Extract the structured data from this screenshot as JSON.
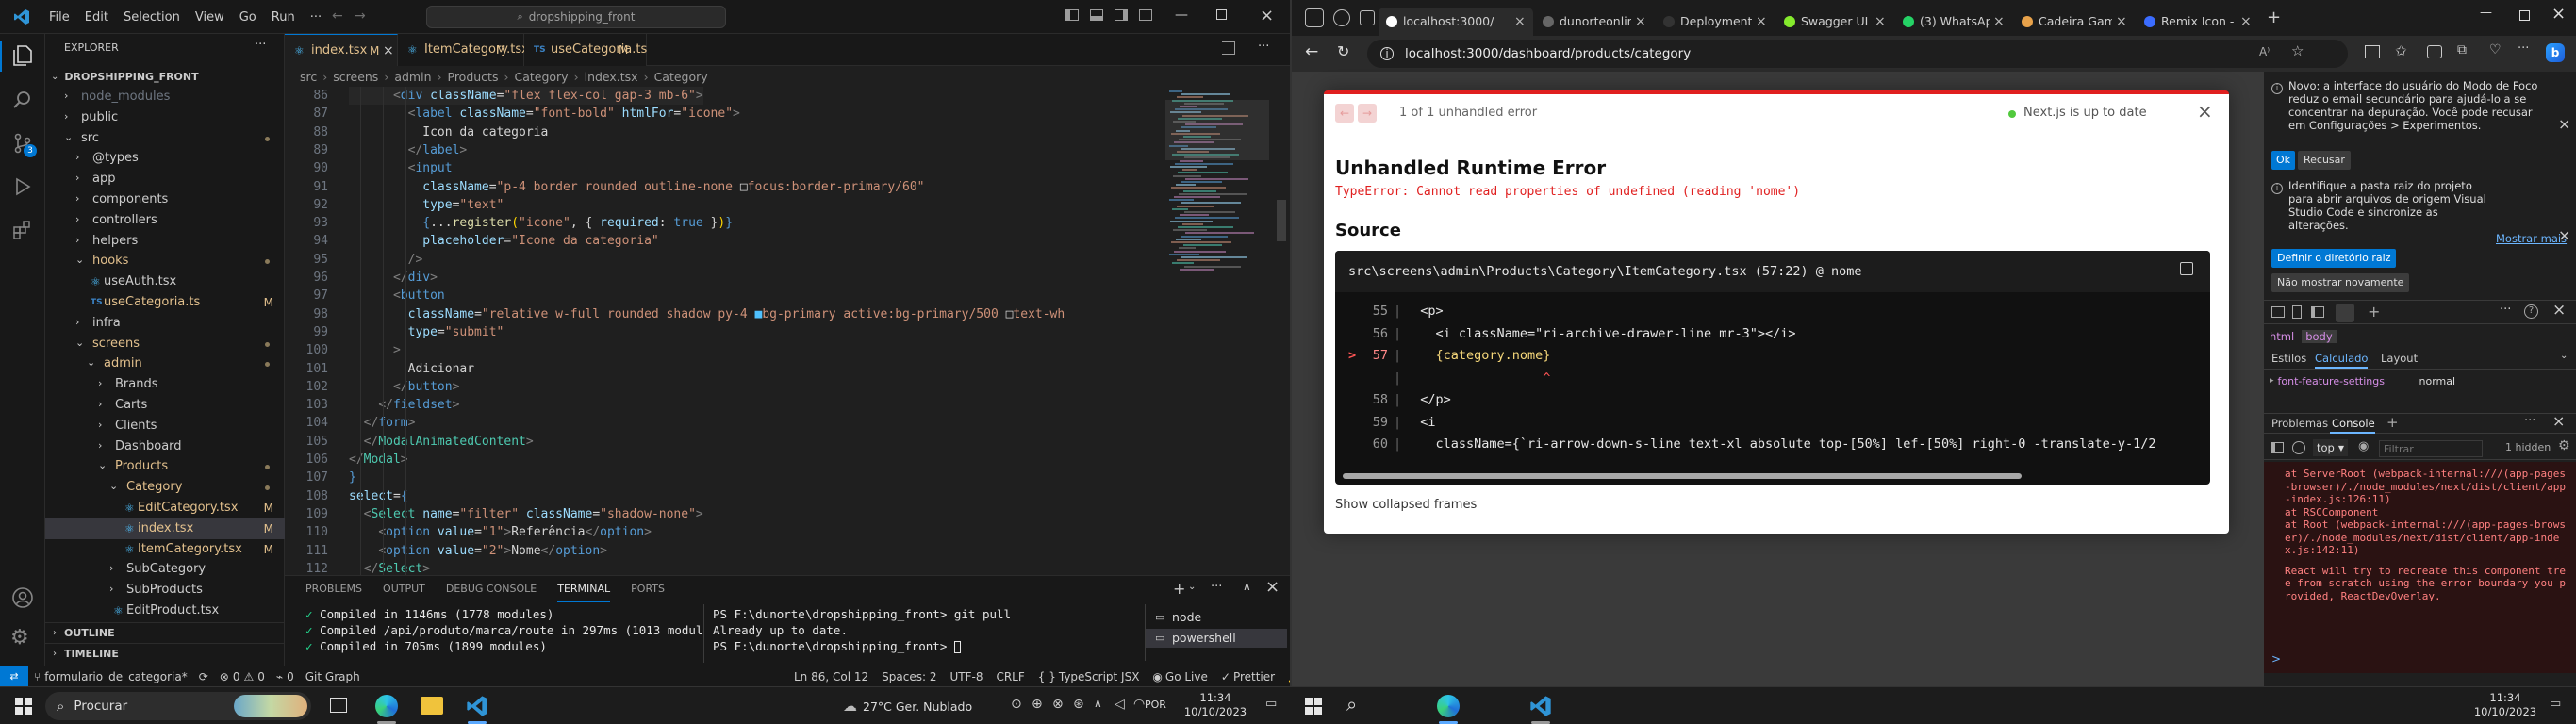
{
  "vscode": {
    "menu": [
      "File",
      "Edit",
      "Selection",
      "View",
      "Go",
      "Run"
    ],
    "menu_more": "···",
    "search_text": "dropshipping_front",
    "explorer": {
      "title": "EXPLORER",
      "more": "···",
      "root": "DROPSHIPPING_FRONT",
      "items": [
        {
          "label": "node_modules",
          "indent": 1,
          "kind": "folder",
          "open": false,
          "color": "#6e7681"
        },
        {
          "label": "public",
          "indent": 1,
          "kind": "folder",
          "open": false,
          "color": "#cccccc"
        },
        {
          "label": "src",
          "indent": 1,
          "kind": "folder",
          "open": true,
          "color": "#cccccc",
          "dot": true
        },
        {
          "label": "@types",
          "indent": 2,
          "kind": "folder",
          "open": false,
          "color": "#cccccc"
        },
        {
          "label": "app",
          "indent": 2,
          "kind": "folder",
          "open": false,
          "color": "#cccccc"
        },
        {
          "label": "components",
          "indent": 2,
          "kind": "folder",
          "open": false,
          "color": "#cccccc"
        },
        {
          "label": "controllers",
          "indent": 2,
          "kind": "folder",
          "open": false,
          "color": "#cccccc"
        },
        {
          "label": "helpers",
          "indent": 2,
          "kind": "folder",
          "open": false,
          "color": "#cccccc"
        },
        {
          "label": "hooks",
          "indent": 2,
          "kind": "folder",
          "open": true,
          "color": "#e2c08d",
          "dot": true
        },
        {
          "label": "useAuth.tsx",
          "indent": 3,
          "kind": "file",
          "color": "#cccccc"
        },
        {
          "label": "useCategoria.ts",
          "indent": 3,
          "kind": "file",
          "color": "#e2c08d",
          "badge": "M"
        },
        {
          "label": "infra",
          "indent": 2,
          "kind": "folder",
          "open": false,
          "color": "#cccccc"
        },
        {
          "label": "screens",
          "indent": 2,
          "kind": "folder",
          "open": true,
          "color": "#e2c08d",
          "dot": true
        },
        {
          "label": "admin",
          "indent": 3,
          "kind": "folder",
          "open": true,
          "color": "#e2c08d",
          "dot": true
        },
        {
          "label": "Brands",
          "indent": 4,
          "kind": "folder",
          "open": false,
          "color": "#cccccc"
        },
        {
          "label": "Carts",
          "indent": 4,
          "kind": "folder",
          "open": false,
          "color": "#cccccc"
        },
        {
          "label": "Clients",
          "indent": 4,
          "kind": "folder",
          "open": false,
          "color": "#cccccc"
        },
        {
          "label": "Dashboard",
          "indent": 4,
          "kind": "folder",
          "open": false,
          "color": "#cccccc"
        },
        {
          "label": "Products",
          "indent": 4,
          "kind": "folder",
          "open": true,
          "color": "#e2c08d",
          "dot": true
        },
        {
          "label": "Category",
          "indent": 5,
          "kind": "folder",
          "open": true,
          "color": "#e2c08d",
          "dot": true
        },
        {
          "label": "EditCategory.tsx",
          "indent": 6,
          "kind": "file",
          "color": "#e2c08d",
          "badge": "M"
        },
        {
          "label": "index.tsx",
          "indent": 6,
          "kind": "file",
          "color": "#e2c08d",
          "badge": "M",
          "selected": true
        },
        {
          "label": "ItemCategory.tsx",
          "indent": 6,
          "kind": "file",
          "color": "#e2c08d",
          "badge": "M"
        },
        {
          "label": "SubCategory",
          "indent": 5,
          "kind": "folder",
          "open": false,
          "color": "#cccccc"
        },
        {
          "label": "SubProducts",
          "indent": 5,
          "kind": "folder",
          "open": false,
          "color": "#cccccc"
        },
        {
          "label": "EditProduct.tsx",
          "indent": 5,
          "kind": "file",
          "color": "#cccccc"
        }
      ],
      "outline": "OUTLINE",
      "timeline": "TIMELINE"
    },
    "tabs": [
      {
        "label": "index.tsx",
        "badge": "M",
        "active": true,
        "close": "×"
      },
      {
        "label": "ItemCategory.tsx",
        "badge": "M",
        "active": false
      },
      {
        "label": "useCategoria.ts",
        "badge": "M",
        "active": false
      }
    ],
    "breadcrumb": [
      "src",
      "screens",
      "admin",
      "Products",
      "Category",
      "index.tsx",
      "Category"
    ],
    "code": [
      {
        "n": "86",
        "parts": [
          [
            "      ",
            "tt"
          ],
          [
            "<",
            "tp"
          ],
          [
            "div",
            "tk"
          ],
          [
            " className",
            "ta"
          ],
          [
            "=",
            "tt"
          ],
          [
            "\"flex flex-col gap-3 mb-6\"",
            "ts"
          ],
          [
            ">",
            "tp"
          ]
        ]
      },
      {
        "n": "87",
        "parts": [
          [
            "        ",
            "tt"
          ],
          [
            "<",
            "tp"
          ],
          [
            "label",
            "tk"
          ],
          [
            " className",
            "ta"
          ],
          [
            "=",
            "tt"
          ],
          [
            "\"font-bold\"",
            "ts"
          ],
          [
            " htmlFor",
            "ta"
          ],
          [
            "=",
            "tt"
          ],
          [
            "\"icone\"",
            "ts"
          ],
          [
            ">",
            "tp"
          ]
        ]
      },
      {
        "n": "88",
        "parts": [
          [
            "          Icon da categoria",
            "tt"
          ]
        ]
      },
      {
        "n": "89",
        "parts": [
          [
            "        ",
            "tt"
          ],
          [
            "</",
            "tp"
          ],
          [
            "label",
            "tk"
          ],
          [
            ">",
            "tp"
          ]
        ]
      },
      {
        "n": "90",
        "parts": [
          [
            "        ",
            "tt"
          ],
          [
            "<",
            "tp"
          ],
          [
            "input",
            "tk"
          ]
        ]
      },
      {
        "n": "91",
        "parts": [
          [
            "          className",
            "ta"
          ],
          [
            "=",
            "tt"
          ],
          [
            "\"p-4 border rounded outline-none ",
            "ts"
          ],
          [
            "□",
            "tt"
          ],
          [
            "focus:border-primary/60\"",
            "ts"
          ]
        ]
      },
      {
        "n": "92",
        "parts": [
          [
            "          type",
            "ta"
          ],
          [
            "=",
            "tt"
          ],
          [
            "\"text\"",
            "ts"
          ]
        ]
      },
      {
        "n": "93",
        "parts": [
          [
            "          {",
            "tk"
          ],
          [
            "...",
            "tt"
          ],
          [
            "register",
            "ty"
          ],
          [
            "(",
            "tb"
          ],
          [
            "\"icone\"",
            "ts"
          ],
          [
            ", { ",
            "tt"
          ],
          [
            "required",
            "ta"
          ],
          [
            ": ",
            "tt"
          ],
          [
            "true",
            "tk"
          ],
          [
            " }",
            "tt"
          ],
          [
            ")",
            "tb"
          ],
          [
            "}",
            "tk"
          ]
        ]
      },
      {
        "n": "94",
        "parts": [
          [
            "          placeholder",
            "ta"
          ],
          [
            "=",
            "tt"
          ],
          [
            "\"Icone da categoria\"",
            "ts"
          ]
        ]
      },
      {
        "n": "95",
        "parts": [
          [
            "        />",
            "tp"
          ]
        ]
      },
      {
        "n": "96",
        "parts": [
          [
            "      ",
            "tt"
          ],
          [
            "</",
            "tp"
          ],
          [
            "div",
            "tk"
          ],
          [
            ">",
            "tp"
          ]
        ]
      },
      {
        "n": "97",
        "parts": [
          [
            "      ",
            "tt"
          ],
          [
            "<",
            "tp"
          ],
          [
            "button",
            "tk"
          ]
        ]
      },
      {
        "n": "98",
        "parts": [
          [
            "        className",
            "ta"
          ],
          [
            "=",
            "tt"
          ],
          [
            "\"relative w-full rounded shadow py-4 ",
            "ts"
          ],
          [
            "■",
            "tv"
          ],
          [
            "bg-primary active:bg-primary/500 ",
            "ts"
          ],
          [
            "□",
            "tt"
          ],
          [
            "text-wh",
            "ts"
          ]
        ]
      },
      {
        "n": "99",
        "parts": [
          [
            "        type",
            "ta"
          ],
          [
            "=",
            "tt"
          ],
          [
            "\"submit\"",
            "ts"
          ]
        ]
      },
      {
        "n": "100",
        "parts": [
          [
            "      ",
            "tt"
          ],
          [
            ">",
            "tp"
          ]
        ]
      },
      {
        "n": "101",
        "parts": [
          [
            "        Adicionar",
            "tt"
          ]
        ]
      },
      {
        "n": "102",
        "parts": [
          [
            "      ",
            "tt"
          ],
          [
            "</",
            "tp"
          ],
          [
            "button",
            "tk"
          ],
          [
            ">",
            "tp"
          ]
        ]
      },
      {
        "n": "103",
        "parts": [
          [
            "    ",
            "tt"
          ],
          [
            "</",
            "tp"
          ],
          [
            "fieldset",
            "tk"
          ],
          [
            ">",
            "tp"
          ]
        ]
      },
      {
        "n": "104",
        "parts": [
          [
            "  ",
            "tt"
          ],
          [
            "</",
            "tp"
          ],
          [
            "form",
            "tk"
          ],
          [
            ">",
            "tp"
          ]
        ]
      },
      {
        "n": "105",
        "parts": [
          [
            "  ",
            "tt"
          ],
          [
            "</",
            "tp"
          ],
          [
            "ModalAnimatedContent",
            "tc"
          ],
          [
            ">",
            "tp"
          ]
        ]
      },
      {
        "n": "106",
        "parts": [
          [
            "</",
            "tp"
          ],
          [
            "Modal",
            "tc"
          ],
          [
            ">",
            "tp"
          ]
        ]
      },
      {
        "n": "107",
        "parts": [
          [
            "}",
            "tk"
          ]
        ]
      },
      {
        "n": "108",
        "parts": [
          [
            "select",
            "ta"
          ],
          [
            "=",
            "tt"
          ],
          [
            "{",
            "tk"
          ]
        ]
      },
      {
        "n": "109",
        "parts": [
          [
            "  ",
            "tt"
          ],
          [
            "<",
            "tp"
          ],
          [
            "Select",
            "tc"
          ],
          [
            " name",
            "ta"
          ],
          [
            "=",
            "tt"
          ],
          [
            "\"filter\"",
            "ts"
          ],
          [
            " className",
            "ta"
          ],
          [
            "=",
            "tt"
          ],
          [
            "\"shadow-none\"",
            "ts"
          ],
          [
            ">",
            "tp"
          ]
        ]
      },
      {
        "n": "110",
        "parts": [
          [
            "    ",
            "tt"
          ],
          [
            "<",
            "tp"
          ],
          [
            "option",
            "tk"
          ],
          [
            " value",
            "ta"
          ],
          [
            "=",
            "tt"
          ],
          [
            "\"1\"",
            "ts"
          ],
          [
            ">",
            "tp"
          ],
          [
            "Referência",
            "tt"
          ],
          [
            "</",
            "tp"
          ],
          [
            "option",
            "tk"
          ],
          [
            ">",
            "tp"
          ]
        ]
      },
      {
        "n": "111",
        "parts": [
          [
            "    ",
            "tt"
          ],
          [
            "<",
            "tp"
          ],
          [
            "option",
            "tk"
          ],
          [
            " value",
            "ta"
          ],
          [
            "=",
            "tt"
          ],
          [
            "\"2\"",
            "ts"
          ],
          [
            ">",
            "tp"
          ],
          [
            "Nome",
            "tt"
          ],
          [
            "</",
            "tp"
          ],
          [
            "option",
            "tk"
          ],
          [
            ">",
            "tp"
          ]
        ]
      },
      {
        "n": "112",
        "parts": [
          [
            "  ",
            "tt"
          ],
          [
            "</",
            "tp"
          ],
          [
            "Select",
            "tc"
          ],
          [
            ">",
            "tp"
          ]
        ]
      }
    ],
    "panel": {
      "tabs": [
        "PROBLEMS",
        "OUTPUT",
        "DEBUG CONSOLE",
        "TERMINAL",
        "PORTS"
      ],
      "active_tab": "TERMINAL",
      "left_lines": [
        "Compiled in 1146ms (1778 modules)",
        "Compiled /api/produto/marca/route in 297ms (1013 modules)",
        "Compiled in 705ms (1899 modules)"
      ],
      "right_lines": [
        "PS F:\\dunorte\\dropshipping_front> git pull",
        "Already up to date.",
        "PS F:\\dunorte\\dropshipping_front> "
      ],
      "terminals": [
        "node",
        "powershell"
      ]
    },
    "status": {
      "branch": "formulario_de_categoria*",
      "errors": "0",
      "warnings": "0",
      "ports": "0",
      "git_graph": "Git Graph",
      "position": "Ln 86, Col 12",
      "spaces": "Spaces: 2",
      "encoding": "UTF-8",
      "eol": "CRLF",
      "language": "TypeScript JSX",
      "golive": "Go Live",
      "prettier": "Prettier"
    }
  },
  "browser": {
    "tabs": [
      {
        "label": "localhost:3000/",
        "active": true
      },
      {
        "label": "dunorteonline/d"
      },
      {
        "label": "Deployments"
      },
      {
        "label": "Swagger UI"
      },
      {
        "label": "(3) WhatsApp"
      },
      {
        "label": "Cadeira Gamin"
      },
      {
        "label": "Remix Icon - Op"
      }
    ],
    "url": "localhost:3000/dashboard/products/category",
    "error": {
      "counter": "1 of 1 unhandled error",
      "next_status": "Next.js is up to date",
      "title": "Unhandled Runtime Error",
      "message": "TypeError: Cannot read properties of undefined (reading 'nome')",
      "source_title": "Source",
      "file": "src\\screens\\admin\\Products\\Category\\ItemCategory.tsx (57:22) @ nome",
      "code": [
        {
          "n": "55",
          "text": "  <p>",
          "marker": ""
        },
        {
          "n": "56",
          "text": "    <i className=\"ri-archive-drawer-line mr-3\"></i>",
          "marker": ""
        },
        {
          "n": "57",
          "text": "    {category.nome}",
          "marker": ">"
        },
        {
          "n": "",
          "text": "                  ^",
          "marker": ""
        },
        {
          "n": "58",
          "text": "  </p>",
          "marker": ""
        },
        {
          "n": "59",
          "text": "  <i",
          "marker": ""
        },
        {
          "n": "60",
          "text": "    className={`ri-arrow-down-s-line text-xl absolute top-[50%] lef-[50%] right-0 -translate-y-1/2",
          "marker": ""
        }
      ],
      "collapsed": "Show collapsed frames"
    },
    "devtools": {
      "notice1": "Novo: a interface do usuário do Modo de Foco reduz o email secundário para ajudá-lo a se concentrar na depuração. Você pode recusar em Configurações > Experimentos.",
      "ok": "Ok",
      "recusar": "Recusar",
      "notice2": "Identifique a pasta raiz do projeto para abrir arquivos de origem Visual Studio Code e sincronize as alterações.",
      "mostrar_mais": "Mostrar mais",
      "definir": "Definir o diretório raiz",
      "nao_mostrar": "Não mostrar novamente",
      "crumbs": [
        "html",
        "body"
      ],
      "subtabs": [
        "Estilos",
        "Calculado",
        "Layout"
      ],
      "active_subtab": "Calculado",
      "prop_name": "font-feature-settings",
      "prop_value": "normal",
      "drawer_tabs": [
        "Problemas",
        "Console"
      ],
      "active_drawer": "Console",
      "context": "top",
      "filter_placeholder": "Filtrar",
      "hidden": "1 hidden",
      "console": [
        {
          "text": "    at ServerRoot (webpack-internal:///(app-pages-browser)/./node_modules/next/dist/client/app-index.js:126:11)"
        },
        {
          "text": "    at RSCComponent"
        },
        {
          "text": "    at Root (webpack-internal:///(app-pages-browser)/./node_modules/next/dist/client/app-index.js:142:11)"
        },
        {
          "text": ""
        },
        {
          "text": "React will try to recreate this component tree from scratch using the error boundary you provided, ReactDevOverlay."
        }
      ],
      "prompt": ">"
    }
  },
  "taskbar": {
    "search": "Procurar",
    "weather": "27°C  Ger. Nublado",
    "lang": "POR",
    "time1": "11:34",
    "date1": "10/10/2023",
    "time2": "11:34",
    "date2": "10/10/2023"
  },
  "colors": {
    "accent": "#0078d4",
    "error": "#e02020",
    "modified": "#e2c08d"
  }
}
